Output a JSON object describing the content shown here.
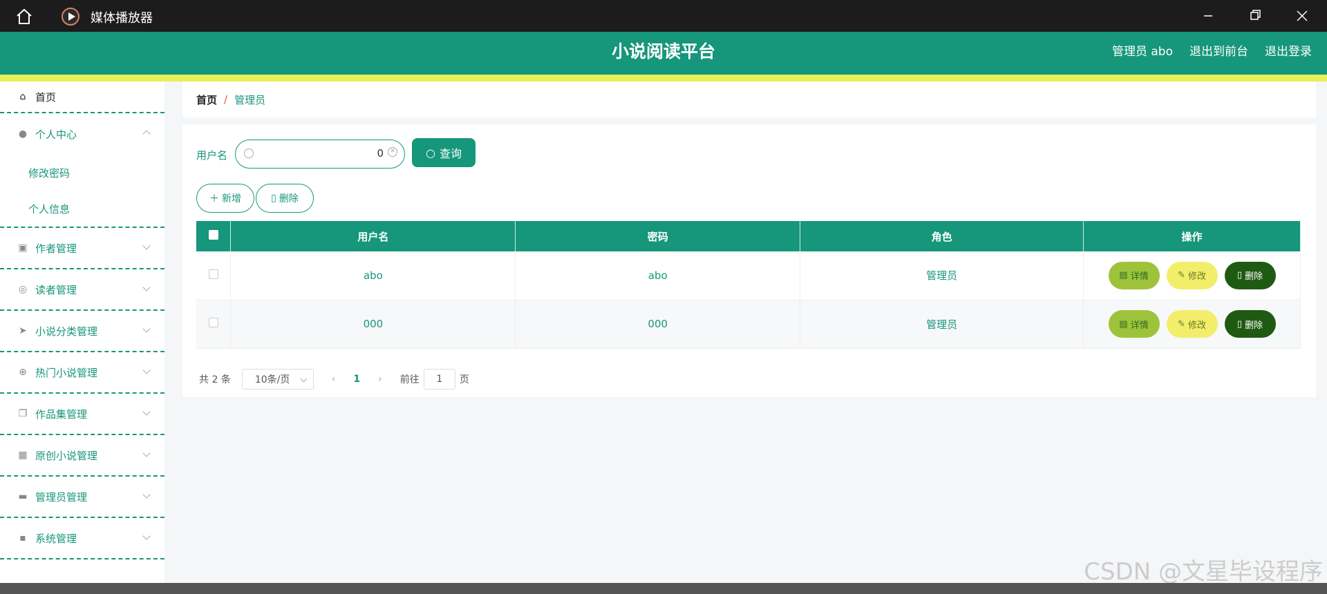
{
  "window": {
    "title": "媒体播放器"
  },
  "header": {
    "brand": "小说阅读平台",
    "links": [
      "管理员 abo",
      "退出到前台",
      "退出登录"
    ]
  },
  "sidebar": {
    "home": "首页",
    "personal": {
      "label": "个人中心",
      "subitems": [
        "修改密码",
        "个人信息"
      ]
    },
    "items": [
      "作者管理",
      "读者管理",
      "小说分类管理",
      "热门小说管理",
      "作品集管理",
      "原创小说管理",
      "管理员管理",
      "系统管理"
    ]
  },
  "breadcrumb": {
    "home": "首页",
    "separator": "/",
    "current": "管理员"
  },
  "search": {
    "label": "用户名",
    "value": "0",
    "button": "查询"
  },
  "actions": {
    "add": "新增",
    "delete": "删除"
  },
  "table": {
    "headers": [
      "用户名",
      "密码",
      "角色",
      "操作"
    ],
    "rows": [
      {
        "username": "abo",
        "password": "abo",
        "role": "管理员"
      },
      {
        "username": "000",
        "password": "000",
        "role": "管理员"
      }
    ],
    "row_actions": [
      "详情",
      "修改",
      "删除"
    ]
  },
  "pager": {
    "total": "共 2 条",
    "size": "10条/页",
    "current": "1",
    "goto_prefix": "前往",
    "goto_value": "1",
    "goto_suffix": "页"
  },
  "watermark": "CSDN @文星毕设程序",
  "colors": {
    "primary": "#16967a",
    "stripe": "#e6ef55"
  }
}
